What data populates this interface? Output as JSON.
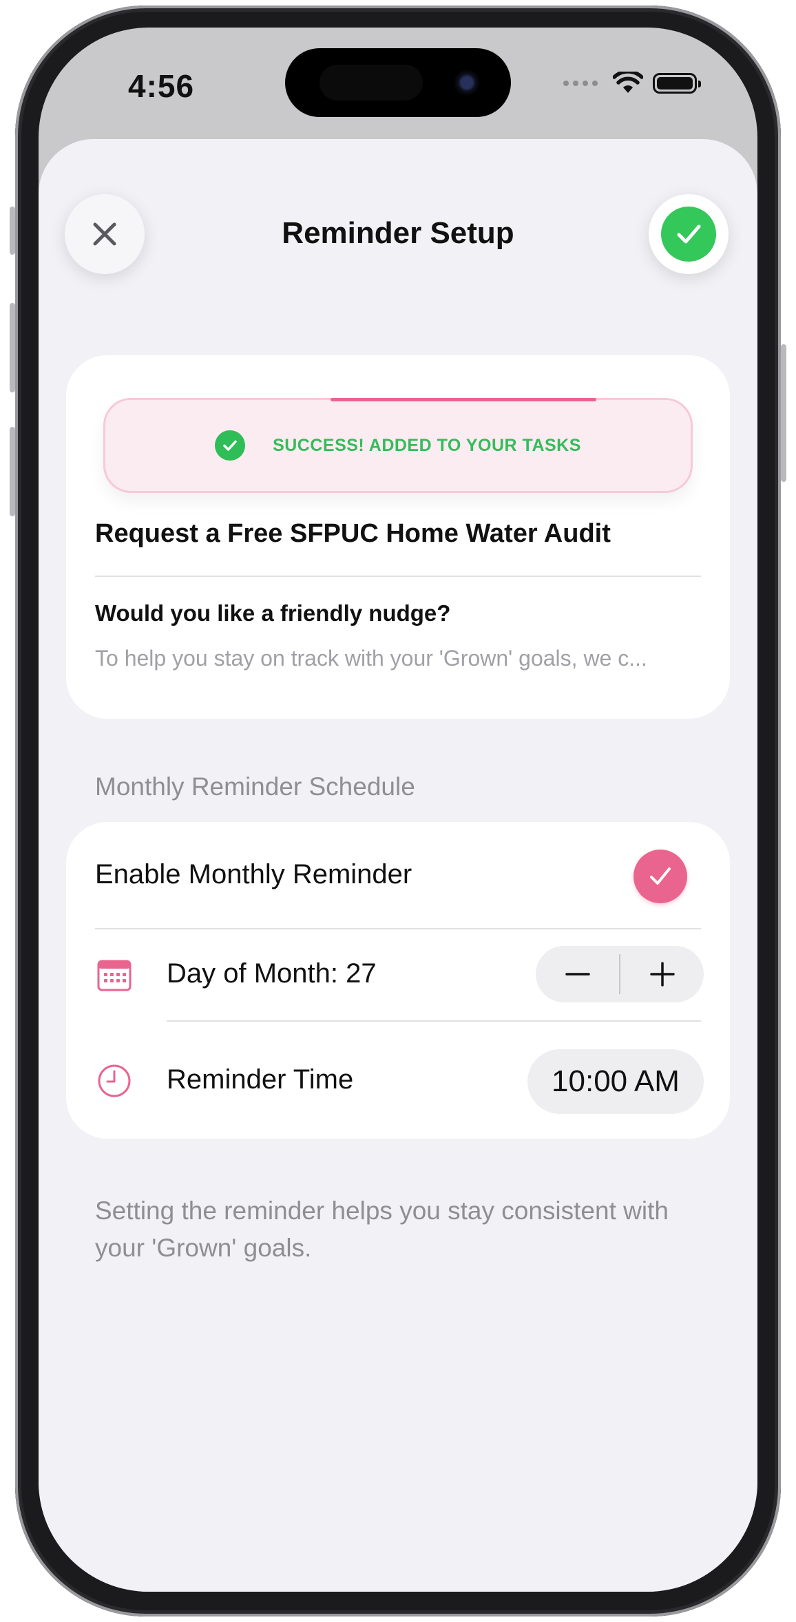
{
  "status_bar": {
    "time": "4:56"
  },
  "header": {
    "title": "Reminder Setup"
  },
  "toast": {
    "message": "SUCCESS! ADDED TO YOUR TASKS"
  },
  "task": {
    "title": "Request a Free SFPUC Home Water Audit",
    "nudge_question": "Would you like a friendly nudge?",
    "nudge_description": "To help you stay on track with your 'Grown' goals, we c..."
  },
  "schedule": {
    "section_title": "Monthly Reminder Schedule",
    "enable_label": "Enable Monthly Reminder",
    "enabled": true,
    "day_of_month_label": "Day of Month: 27",
    "stepper": {
      "minus": "−",
      "plus": "+"
    },
    "time_label": "Reminder Time",
    "time_value": "10:00 AM"
  },
  "footer": {
    "note": "Setting the reminder helps you stay consistent with your 'Grown' goals."
  },
  "colors": {
    "accent_pink": "#e9648f",
    "success_green": "#34c759",
    "background": "#f2f1f6"
  }
}
